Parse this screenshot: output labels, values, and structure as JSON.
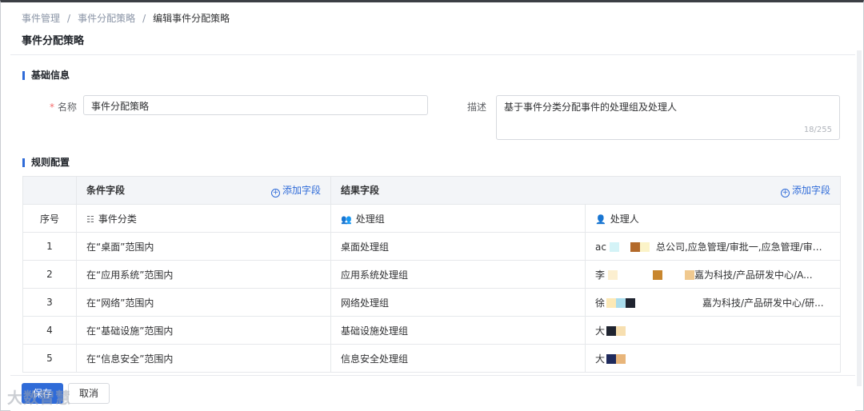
{
  "breadcrumb": [
    "事件管理",
    "事件分配策略",
    "编辑事件分配策略"
  ],
  "breadcrumb_sep": "/",
  "page_title": "事件分配策略",
  "basic_section": {
    "title": "基础信息",
    "name_label": "名称",
    "required_mark": "*",
    "name_value": "事件分配策略",
    "desc_label": "描述",
    "desc_value": "基于事件分类分配事件的处理组及处理人",
    "desc_counter": "18/255"
  },
  "rules_section": {
    "title": "规则配置",
    "col_condition": "条件字段",
    "col_result": "结果字段",
    "add_field": "添加字段",
    "col_index": "序号",
    "sub_condition": "事件分类",
    "sub_group": "处理组",
    "sub_handler": "处理人",
    "rows": [
      {
        "index": "1",
        "condition": "在“桌面”范围内",
        "group": "桌面处理组",
        "handler_start": "ac",
        "handler_end": "总公司,应急管理/审批一,应急管理/审批二)"
      },
      {
        "index": "2",
        "condition": "在“应用系统”范围内",
        "group": "应用系统处理组",
        "handler_start": "李",
        "handler_end": "嘉为科技/产品研发中心/A..."
      },
      {
        "index": "3",
        "condition": "在“网络”范围内",
        "group": "网络处理组",
        "handler_start": "徐",
        "handler_end": "嘉为科技/产品研发中心/研..."
      },
      {
        "index": "4",
        "condition": "在“基础设施”范围内",
        "group": "基础设施处理组",
        "handler_start": "大",
        "handler_end": ""
      },
      {
        "index": "5",
        "condition": "在“信息安全”范围内",
        "group": "信息安全处理组",
        "handler_start": "大",
        "handler_end": ""
      }
    ]
  },
  "footer": {
    "save_label": "保存",
    "cancel_label": "取消"
  },
  "watermark": "大数智慧",
  "colors": {
    "accent": "#2f6bd8",
    "required": "#f56c6c"
  }
}
